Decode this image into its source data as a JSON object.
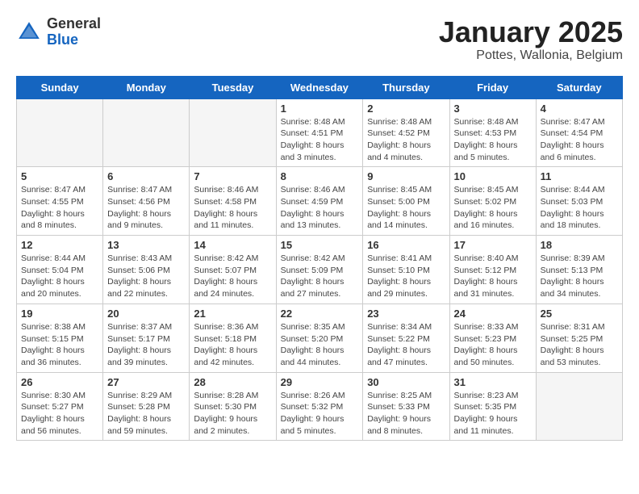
{
  "header": {
    "logo_general": "General",
    "logo_blue": "Blue",
    "title": "January 2025",
    "subtitle": "Pottes, Wallonia, Belgium"
  },
  "weekdays": [
    "Sunday",
    "Monday",
    "Tuesday",
    "Wednesday",
    "Thursday",
    "Friday",
    "Saturday"
  ],
  "weeks": [
    [
      {
        "day": "",
        "info": ""
      },
      {
        "day": "",
        "info": ""
      },
      {
        "day": "",
        "info": ""
      },
      {
        "day": "1",
        "info": "Sunrise: 8:48 AM\nSunset: 4:51 PM\nDaylight: 8 hours\nand 3 minutes."
      },
      {
        "day": "2",
        "info": "Sunrise: 8:48 AM\nSunset: 4:52 PM\nDaylight: 8 hours\nand 4 minutes."
      },
      {
        "day": "3",
        "info": "Sunrise: 8:48 AM\nSunset: 4:53 PM\nDaylight: 8 hours\nand 5 minutes."
      },
      {
        "day": "4",
        "info": "Sunrise: 8:47 AM\nSunset: 4:54 PM\nDaylight: 8 hours\nand 6 minutes."
      }
    ],
    [
      {
        "day": "5",
        "info": "Sunrise: 8:47 AM\nSunset: 4:55 PM\nDaylight: 8 hours\nand 8 minutes."
      },
      {
        "day": "6",
        "info": "Sunrise: 8:47 AM\nSunset: 4:56 PM\nDaylight: 8 hours\nand 9 minutes."
      },
      {
        "day": "7",
        "info": "Sunrise: 8:46 AM\nSunset: 4:58 PM\nDaylight: 8 hours\nand 11 minutes."
      },
      {
        "day": "8",
        "info": "Sunrise: 8:46 AM\nSunset: 4:59 PM\nDaylight: 8 hours\nand 13 minutes."
      },
      {
        "day": "9",
        "info": "Sunrise: 8:45 AM\nSunset: 5:00 PM\nDaylight: 8 hours\nand 14 minutes."
      },
      {
        "day": "10",
        "info": "Sunrise: 8:45 AM\nSunset: 5:02 PM\nDaylight: 8 hours\nand 16 minutes."
      },
      {
        "day": "11",
        "info": "Sunrise: 8:44 AM\nSunset: 5:03 PM\nDaylight: 8 hours\nand 18 minutes."
      }
    ],
    [
      {
        "day": "12",
        "info": "Sunrise: 8:44 AM\nSunset: 5:04 PM\nDaylight: 8 hours\nand 20 minutes."
      },
      {
        "day": "13",
        "info": "Sunrise: 8:43 AM\nSunset: 5:06 PM\nDaylight: 8 hours\nand 22 minutes."
      },
      {
        "day": "14",
        "info": "Sunrise: 8:42 AM\nSunset: 5:07 PM\nDaylight: 8 hours\nand 24 minutes."
      },
      {
        "day": "15",
        "info": "Sunrise: 8:42 AM\nSunset: 5:09 PM\nDaylight: 8 hours\nand 27 minutes."
      },
      {
        "day": "16",
        "info": "Sunrise: 8:41 AM\nSunset: 5:10 PM\nDaylight: 8 hours\nand 29 minutes."
      },
      {
        "day": "17",
        "info": "Sunrise: 8:40 AM\nSunset: 5:12 PM\nDaylight: 8 hours\nand 31 minutes."
      },
      {
        "day": "18",
        "info": "Sunrise: 8:39 AM\nSunset: 5:13 PM\nDaylight: 8 hours\nand 34 minutes."
      }
    ],
    [
      {
        "day": "19",
        "info": "Sunrise: 8:38 AM\nSunset: 5:15 PM\nDaylight: 8 hours\nand 36 minutes."
      },
      {
        "day": "20",
        "info": "Sunrise: 8:37 AM\nSunset: 5:17 PM\nDaylight: 8 hours\nand 39 minutes."
      },
      {
        "day": "21",
        "info": "Sunrise: 8:36 AM\nSunset: 5:18 PM\nDaylight: 8 hours\nand 42 minutes."
      },
      {
        "day": "22",
        "info": "Sunrise: 8:35 AM\nSunset: 5:20 PM\nDaylight: 8 hours\nand 44 minutes."
      },
      {
        "day": "23",
        "info": "Sunrise: 8:34 AM\nSunset: 5:22 PM\nDaylight: 8 hours\nand 47 minutes."
      },
      {
        "day": "24",
        "info": "Sunrise: 8:33 AM\nSunset: 5:23 PM\nDaylight: 8 hours\nand 50 minutes."
      },
      {
        "day": "25",
        "info": "Sunrise: 8:31 AM\nSunset: 5:25 PM\nDaylight: 8 hours\nand 53 minutes."
      }
    ],
    [
      {
        "day": "26",
        "info": "Sunrise: 8:30 AM\nSunset: 5:27 PM\nDaylight: 8 hours\nand 56 minutes."
      },
      {
        "day": "27",
        "info": "Sunrise: 8:29 AM\nSunset: 5:28 PM\nDaylight: 8 hours\nand 59 minutes."
      },
      {
        "day": "28",
        "info": "Sunrise: 8:28 AM\nSunset: 5:30 PM\nDaylight: 9 hours\nand 2 minutes."
      },
      {
        "day": "29",
        "info": "Sunrise: 8:26 AM\nSunset: 5:32 PM\nDaylight: 9 hours\nand 5 minutes."
      },
      {
        "day": "30",
        "info": "Sunrise: 8:25 AM\nSunset: 5:33 PM\nDaylight: 9 hours\nand 8 minutes."
      },
      {
        "day": "31",
        "info": "Sunrise: 8:23 AM\nSunset: 5:35 PM\nDaylight: 9 hours\nand 11 minutes."
      },
      {
        "day": "",
        "info": ""
      }
    ]
  ]
}
